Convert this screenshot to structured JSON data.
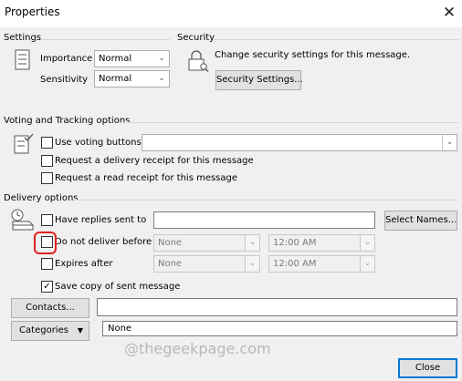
{
  "window": {
    "title": "Properties"
  },
  "icons": {
    "close": "close-icon",
    "settings": "list-icon",
    "security": "lock-icon",
    "voting": "voting-icon",
    "delivery": "delivery-icon"
  },
  "settings": {
    "heading": "Settings",
    "importance_label": "Importance",
    "importance_value": "Normal",
    "sensitivity_label": "Sensitivity",
    "sensitivity_value": "Normal"
  },
  "security": {
    "heading": "Security",
    "description": "Change security settings for this message.",
    "button": "Security Settings..."
  },
  "voting": {
    "heading": "Voting and Tracking options",
    "use_voting_label": "Use voting buttons",
    "use_voting_checked": false,
    "voting_value": "",
    "delivery_receipt_label": "Request a delivery receipt for this message",
    "delivery_receipt_checked": false,
    "read_receipt_label": "Request a read receipt for this message",
    "read_receipt_checked": false
  },
  "delivery": {
    "heading": "Delivery options",
    "replies_label": "Have replies sent to",
    "replies_checked": false,
    "replies_value": "",
    "select_names_button": "Select Names...",
    "no_deliver_label": "Do not deliver before",
    "no_deliver_checked": false,
    "no_deliver_date": "None",
    "no_deliver_time": "12:00 AM",
    "expires_label": "Expires after",
    "expires_checked": false,
    "expires_date": "None",
    "expires_time": "12:00 AM",
    "save_copy_label": "Save copy of sent message",
    "save_copy_checked": true,
    "save_copy_mark": "✓"
  },
  "contacts": {
    "button": "Contacts...",
    "value": ""
  },
  "categories": {
    "button": "Categories",
    "value": "None"
  },
  "watermark": "@thegeekpage.com",
  "footer": {
    "close_button": "Close"
  },
  "colors": {
    "highlight": "#e02020",
    "focus_border": "#0078d7"
  }
}
